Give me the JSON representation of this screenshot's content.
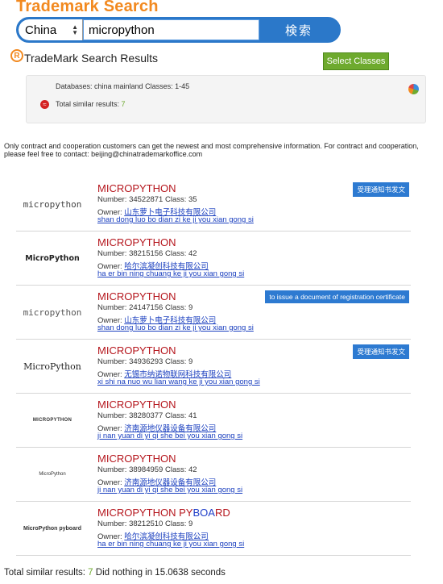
{
  "header": {
    "brand": "Trademark Search",
    "country": "China",
    "query": "micropython",
    "search_button": "検索"
  },
  "results_header": {
    "title": "TradeMark Search Results",
    "classes_button": "Select Classes"
  },
  "infobox": {
    "databases_line": "Databases: china mainland Classes: 1-45",
    "total_label": "Total similar results:",
    "total_count": "7"
  },
  "notice": "Only contract and cooperation customers can get the newest and most comprehensive information. For contract and cooperation, please feel free to contact: beijing@chinatrademarkoffice.com",
  "items": [
    {
      "logo": "micropython",
      "name": "MICROPYTHON",
      "name_suffix": "",
      "number_line": "Number: 34522871 Class: 35",
      "owner_label": "Owner:",
      "owner": "山东萝卜电子科技有限公司",
      "pinyin": "shan dong luo bo dian zi ke ji you xian gong si",
      "tag": "受理通知书发文"
    },
    {
      "logo": "MicroPython",
      "name": "MICROPYTHON",
      "name_suffix": "",
      "number_line": "Number: 38215156 Class: 42",
      "owner_label": "Owner:",
      "owner": "哈尔滨凝创科技有限公司",
      "pinyin": "ha er bin ning chuang ke ji you xian gong si",
      "tag": ""
    },
    {
      "logo": "micropython",
      "name": "MICROPYTHON",
      "name_suffix": "",
      "number_line": "Number: 24147156 Class: 9",
      "owner_label": "Owner:",
      "owner": "山东萝卜电子科技有限公司",
      "pinyin": "shan dong luo bo dian zi ke ji you xian gong si",
      "tag": "to issue a document of registration certificate"
    },
    {
      "logo": "MicroPython",
      "name": "MICROPYTHON",
      "name_suffix": "",
      "number_line": "Number: 34936293 Class: 9",
      "owner_label": "Owner:",
      "owner": "无锡市纳诺物联网科技有限公司",
      "pinyin": "xi shi na nuo wu lian wang ke ji you xian gong si",
      "tag": "受理通知书发文"
    },
    {
      "logo": "MICROPYTHON",
      "name": "MICROPYTHON",
      "name_suffix": "",
      "number_line": "Number: 38280377 Class: 41",
      "owner_label": "Owner:",
      "owner": "济南源地仪器设备有限公司",
      "pinyin": "ji nan yuan di yi qi she bei you xian gong si",
      "tag": ""
    },
    {
      "logo": "MicroPython",
      "name": "MICROPYTHON",
      "name_suffix": "",
      "number_line": "Number: 38984959 Class: 42",
      "owner_label": "Owner:",
      "owner": "济南源地仪器设备有限公司",
      "pinyin": "ji nan yuan di yi qi she bei you xian gong si",
      "tag": ""
    },
    {
      "logo": "MicroPython pyboard",
      "name": "MICROPYTHON PY",
      "name_blue": "BOA",
      "name_tail": "RD",
      "number_line": "Number: 38212510 Class: 9",
      "owner_label": "Owner:",
      "owner": "哈尔滨凝创科技有限公司",
      "pinyin": "ha er bin ning chuang ke ji you xian gong si",
      "tag": ""
    }
  ],
  "footer": {
    "label": "Total similar results:",
    "count": "7",
    "tail": "Did nothing in 15.0638 seconds"
  },
  "colors": {
    "brand_orange": "#f2891f",
    "search_blue": "#2b78c9",
    "name_red": "#b5161d",
    "tag_blue": "#2d7ad1",
    "count_green": "#6eaa2e"
  }
}
